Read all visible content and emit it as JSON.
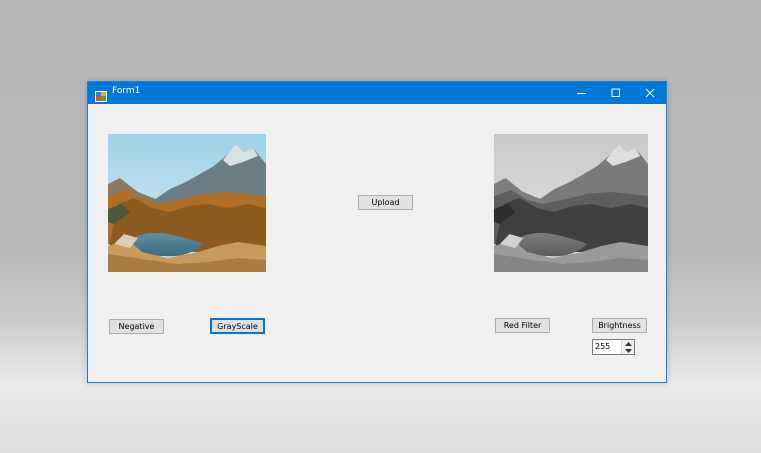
{
  "window": {
    "title": "Form1",
    "icons": {
      "app": "form-app-icon",
      "minimize": "minimize-icon",
      "maximize": "maximize-icon",
      "close": "close-icon"
    }
  },
  "buttons": {
    "upload": "Upload",
    "negative": "Negative",
    "grayscale": "GrayScale",
    "red_filter": "Red Filter",
    "brightness": "Brightness"
  },
  "brightness_input": {
    "value": "255"
  },
  "images": {
    "original": "mountain-lake-landscape",
    "processed": "mountain-lake-landscape-grayscale"
  },
  "colors": {
    "titlebar": "#0078d7",
    "window_bg": "#f0f0f0",
    "button_bg": "#e1e1e1",
    "focus_border": "#0078d7"
  }
}
